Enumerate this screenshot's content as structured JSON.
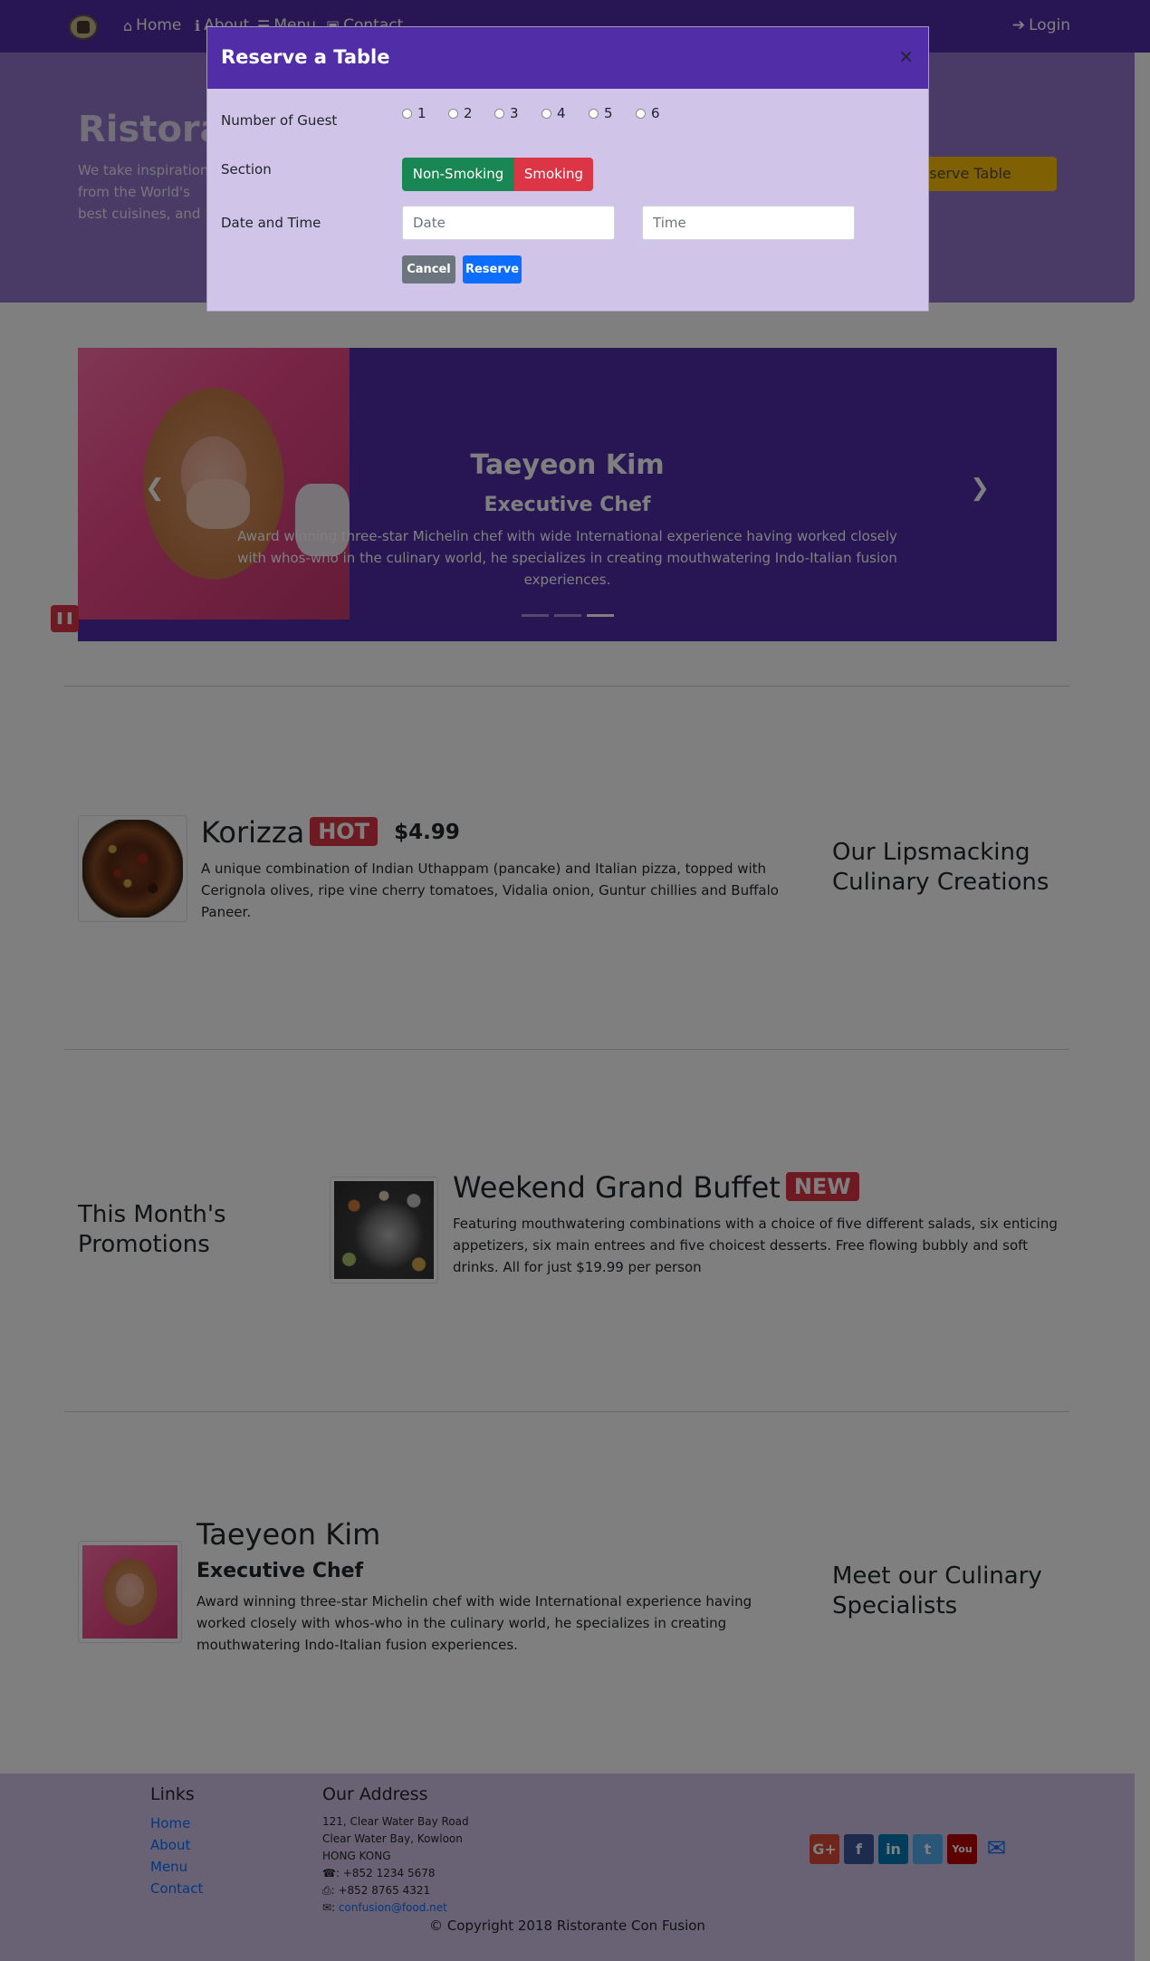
{
  "navbar": {
    "items": [
      {
        "label": "Home",
        "icon": "home-icon"
      },
      {
        "label": "About",
        "icon": "info-icon"
      },
      {
        "label": "Menu",
        "icon": "list-icon"
      },
      {
        "label": "Contact",
        "icon": "address-card-icon"
      }
    ],
    "login_label": "Login",
    "color": "#512da8"
  },
  "jumbotron": {
    "title": "Ristorante Con Fusion",
    "text": "We take inspiration from the World's best cuisines, and create a unique fusion experience. Our lipsmacking creations will tickle your culinary senses!",
    "reserve_button_label": "Reserve Table",
    "color": "#9575cd"
  },
  "carousel": {
    "name": "Taeyeon Kim",
    "role": "Executive Chef",
    "description": "Award winning three-star Michelin chef with wide International experience having worked closely with whos-who in the culinary world, he specializes in creating mouthwatering Indo-Italian fusion experiences.",
    "slide_count": 3,
    "active_slide": 3
  },
  "dish": {
    "title": "Korizza",
    "badge": "HOT",
    "price": "$4.99",
    "description": "A unique combination of Indian Uthappam (pancake) and Italian pizza, topped with Cerignola olives, ripe vine cherry tomatoes, Vidalia onion, Guntur chillies and Buffalo Paneer.",
    "side_heading": "Our Lipsmacking Culinary Creations"
  },
  "promotion": {
    "side_heading": "This Month's Promotions",
    "title": "Weekend Grand Buffet",
    "badge": "NEW",
    "description": "Featuring mouthwatering combinations with a choice of five different salads, six enticing appetizers, six main entrees and five choicest desserts. Free flowing bubbly and soft drinks. All for just $19.99 per person"
  },
  "leader": {
    "name": "Taeyeon Kim",
    "role": "Executive Chef",
    "description": "Award winning three-star Michelin chef with wide International experience having worked closely with whos-who in the culinary world, he specializes in creating mouthwatering Indo-Italian fusion experiences.",
    "side_heading": "Meet our Culinary Specialists"
  },
  "footer": {
    "links_heading": "Links",
    "links": [
      "Home",
      "About",
      "Menu",
      "Contact"
    ],
    "address_heading": "Our Address",
    "address_lines": [
      "121, Clear Water Bay Road",
      "Clear Water Bay, Kowloon",
      "HONG KONG"
    ],
    "phone": ": +852 1234 5678",
    "fax": ": +852 8765 4321",
    "email": "confusion@food.net",
    "social": [
      {
        "name": "google-plus-icon",
        "glyph": "G+",
        "color": "#dd4b39"
      },
      {
        "name": "facebook-icon",
        "glyph": "f",
        "color": "#3b5998"
      },
      {
        "name": "linkedin-icon",
        "glyph": "in",
        "color": "#007bb6"
      },
      {
        "name": "twitter-icon",
        "glyph": "t",
        "color": "#55acee"
      },
      {
        "name": "youtube-icon",
        "glyph": "You",
        "color": "#bb0000"
      },
      {
        "name": "mail-icon",
        "glyph": "✉",
        "color": "#0d6efd"
      }
    ],
    "copyright": "© Copyright 2018 Ristorante Con Fusion"
  },
  "modal": {
    "title": "Reserve a Table",
    "close_glyph": "×",
    "guests_label": "Number of Guest",
    "guest_options": [
      "1",
      "2",
      "3",
      "4",
      "5",
      "6"
    ],
    "section_label": "Section",
    "section_options": [
      "Non-Smoking",
      "Smoking"
    ],
    "datetime_label": "Date and Time",
    "date_placeholder": "Date",
    "time_placeholder": "Time",
    "cancel_label": "Cancel",
    "reserve_label": "Reserve"
  }
}
